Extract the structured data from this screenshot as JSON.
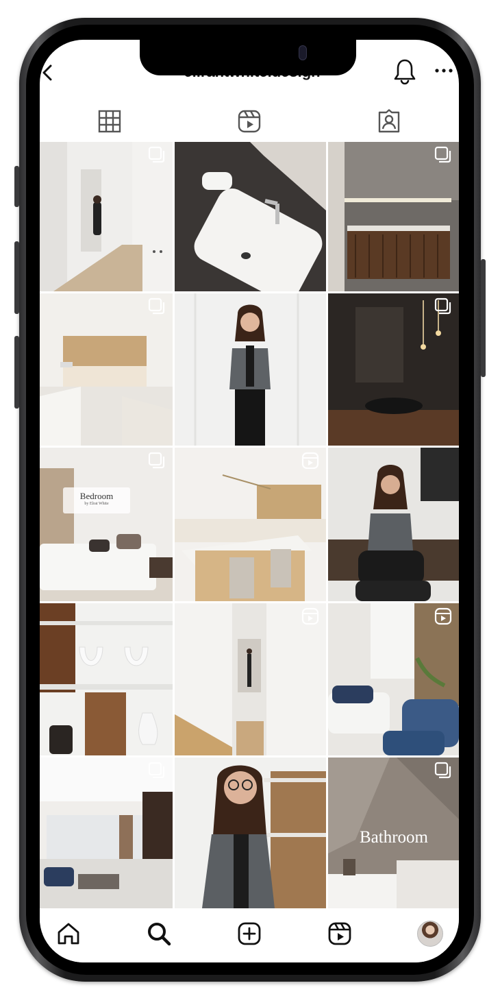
{
  "header": {
    "username": "elirantwhite.design"
  },
  "icons": {
    "back": "chevron-left-icon",
    "notifications": "bell-icon",
    "more": "more-horizontal-icon"
  },
  "tabs": [
    {
      "name": "posts-grid",
      "icon": "grid-icon",
      "active": true
    },
    {
      "name": "reels",
      "icon": "reels-icon",
      "active": false
    },
    {
      "name": "tagged",
      "icon": "tagged-person-icon",
      "active": false
    }
  ],
  "grid": {
    "posts": [
      {
        "subject": "white hallway with woman",
        "badge": "multi-photo-icon",
        "label": ""
      },
      {
        "subject": "marble sink with towels",
        "badge": "",
        "label": ""
      },
      {
        "subject": "wood vanity bathroom",
        "badge": "multi-photo-icon",
        "label": ""
      },
      {
        "subject": "white and wood kitchen",
        "badge": "multi-photo-icon",
        "label": ""
      },
      {
        "subject": "woman portrait white wall",
        "badge": "",
        "label": ""
      },
      {
        "subject": "dark bathroom vessel sink",
        "badge": "multi-photo-icon",
        "label": ""
      },
      {
        "subject": "bedroom",
        "badge": "multi-photo-icon",
        "label": "Bedroom",
        "sublabel": "by Elrat White"
      },
      {
        "subject": "kitchen island with stools",
        "badge": "reel-icon",
        "label": ""
      },
      {
        "subject": "woman seated in kitchen",
        "badge": "",
        "label": ""
      },
      {
        "subject": "white vases on shelves",
        "badge": "",
        "label": ""
      },
      {
        "subject": "corridor with woman",
        "badge": "reel-icon",
        "label": ""
      },
      {
        "subject": "living room blue sofa",
        "badge": "reel-icon",
        "label": ""
      },
      {
        "subject": "open living area",
        "badge": "multi-photo-icon",
        "label": ""
      },
      {
        "subject": "woman with glasses portrait",
        "badge": "",
        "label": ""
      },
      {
        "subject": "bathroom",
        "badge": "multi-photo-icon",
        "label": "Bathroom"
      }
    ]
  },
  "bottom_nav": [
    {
      "name": "home",
      "icon": "home-icon"
    },
    {
      "name": "search",
      "icon": "search-icon"
    },
    {
      "name": "create",
      "icon": "create-plus-icon"
    },
    {
      "name": "reels",
      "icon": "reels-icon"
    },
    {
      "name": "profile",
      "icon": "profile-avatar-icon"
    }
  ]
}
